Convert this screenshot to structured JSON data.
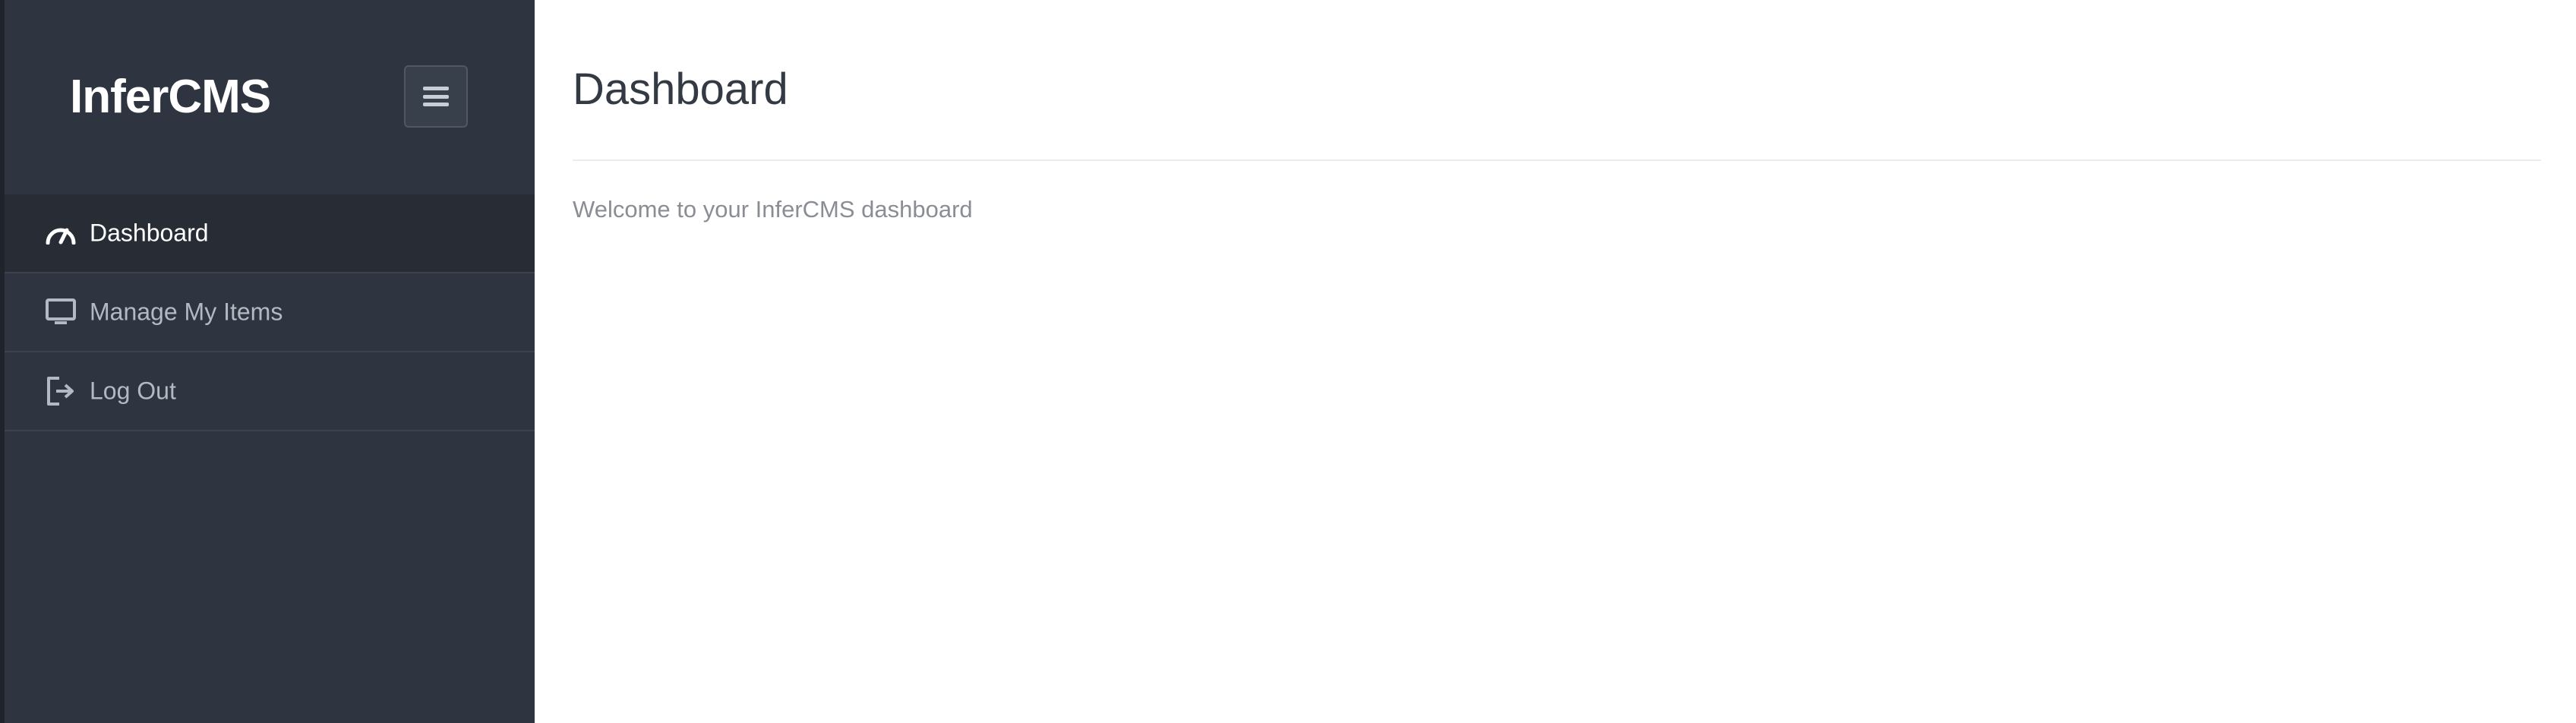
{
  "app": {
    "brand": "InferCMS"
  },
  "sidebar": {
    "toggle_icon": "hamburger-menu-icon",
    "items": [
      {
        "label": "Dashboard",
        "icon": "dashboard-gauge-icon",
        "active": true
      },
      {
        "label": "Manage My Items",
        "icon": "monitor-icon",
        "active": false
      },
      {
        "label": "Log Out",
        "icon": "sign-out-icon",
        "active": false
      }
    ]
  },
  "main": {
    "title": "Dashboard",
    "welcome": "Welcome to your InferCMS dashboard"
  },
  "colors": {
    "sidebar_bg": "#2f3540",
    "active_item_bg": "#272c35",
    "inactive_text": "#b3b9c2",
    "title_text": "#343a44",
    "muted_text": "#8a8e94"
  }
}
